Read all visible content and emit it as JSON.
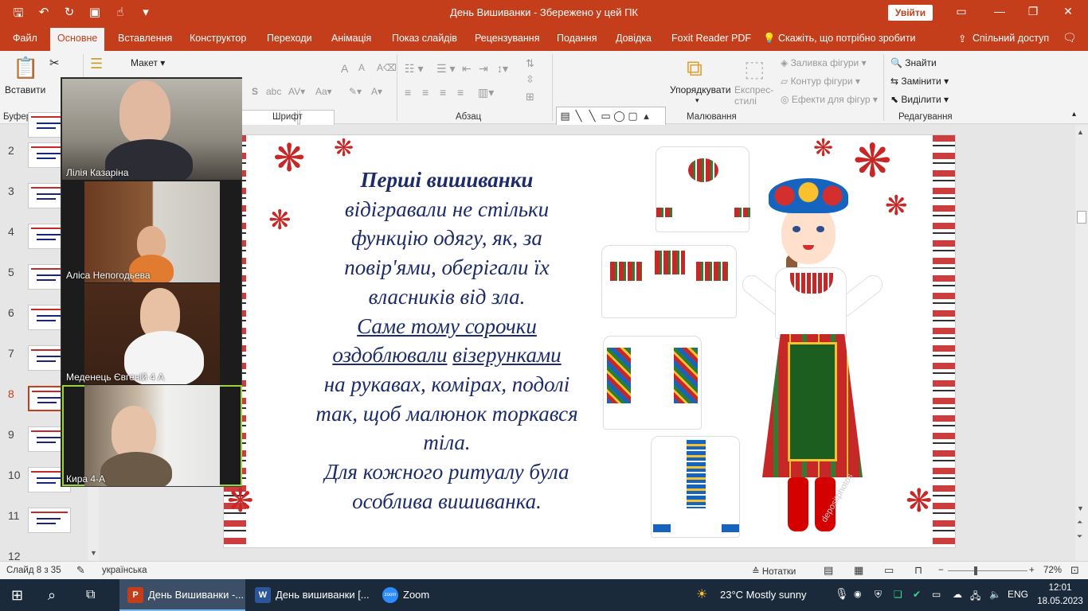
{
  "window": {
    "title": "День Вишиванки  -  Збережено у цей ПК",
    "signin_label": "Увійти"
  },
  "menu_tabs": [
    "Файл",
    "Основне",
    "Вставлення",
    "Конструктор",
    "Переходи",
    "Анімація",
    "Показ слайдів",
    "Рецензування",
    "Подання",
    "Довідка",
    "Foxit Reader PDF",
    "Скажіть, що потрібно зробити",
    "Спільний доступ"
  ],
  "ribbon": {
    "paste_label": "Вставити",
    "clipboard_group": "Буфер обміну",
    "layout_label": "Макет",
    "font_group": "Шрифт",
    "paragraph_group": "Абзац",
    "arrange_label": "Упорядкувати",
    "quick_styles_label": "Експрес-стилі",
    "shape_fill": "Заливка фігури",
    "shape_outline": "Контур фігури",
    "shape_effects": "Ефекти для фігур",
    "drawing_group": "Малювання",
    "find_label": "Знайти",
    "replace_label": "Замінити",
    "select_label": "Виділити",
    "editing_group": "Редагування"
  },
  "thumbnails": [
    {
      "num": "2"
    },
    {
      "num": "3"
    },
    {
      "num": "4"
    },
    {
      "num": "5"
    },
    {
      "num": "6"
    },
    {
      "num": "7"
    },
    {
      "num": "8"
    },
    {
      "num": "9"
    },
    {
      "num": "10"
    },
    {
      "num": "11"
    },
    {
      "num": "12"
    }
  ],
  "slide": {
    "heading": "Перші вишиванки",
    "lines": [
      "відігравали не стільки",
      "функцію одягу, як, за",
      "повір'ями, оберігали їх",
      "власників від зла."
    ],
    "underlined_1": "Саме тому сорочки",
    "underlined_2a": "оздоблювали",
    "underlined_2b": "візерунками",
    "lines2": [
      "на рукавах, комірах, подолі",
      "так, щоб малюнок торкався",
      "тіла.",
      "Для кожного ритуалу була",
      "особлива вишиванка."
    ],
    "watermark": "depositphotos"
  },
  "zoom_participants": [
    {
      "name": "Лілія Казаріна"
    },
    {
      "name": "Аліса Непогодьева"
    },
    {
      "name": "Меденець Євгеній 4 А"
    },
    {
      "name": "Кира 4-А"
    }
  ],
  "statusbar": {
    "slide_info": "Слайд 8 з 35",
    "language": "українська",
    "notes_label": "Нотатки",
    "zoom_level": "72%"
  },
  "taskbar": {
    "apps": [
      {
        "label": "День Вишиванки -...",
        "icon": "P",
        "color": "#c43e1c"
      },
      {
        "label": "День вишиванки [...",
        "icon": "W",
        "color": "#2b579a"
      },
      {
        "label": "Zoom",
        "icon": "zoom",
        "color": "#2d8cff"
      }
    ],
    "weather": "23°C  Mostly sunny",
    "lang": "ENG",
    "time": "12:01",
    "date": "18.05.2023"
  }
}
